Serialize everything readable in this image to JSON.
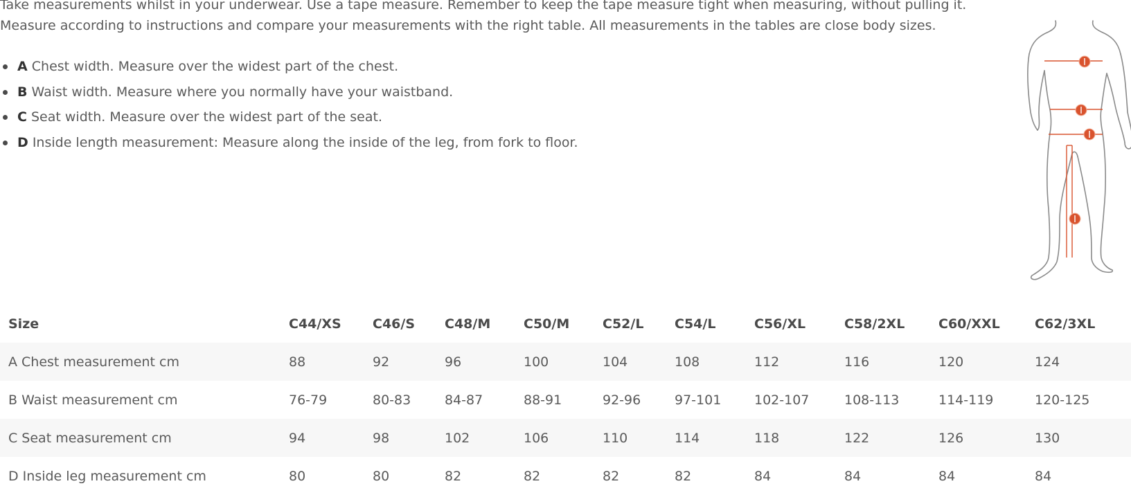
{
  "intro": {
    "line1": "Take measurements whilst in your underwear. Use a tape measure. Remember to keep the tape measure tight when measuring, without pulling it.",
    "line2": "Measure according to instructions and compare your measurements with the right table. All measurements in the tables are close body sizes."
  },
  "instructions": [
    {
      "key": "A",
      "text": " Chest width. Measure over the widest part of the chest."
    },
    {
      "key": "B",
      "text": " Waist width. Measure where you normally have your waistband."
    },
    {
      "key": "C",
      "text": " Seat width. Measure over the widest part of the seat."
    },
    {
      "key": "D",
      "text": " Inside length measurement: Measure along the inside of the leg, from fork to floor."
    }
  ],
  "figure": {
    "icon": "body-measurement-figure",
    "marker_color": "#d9532e",
    "outline_color": "#8a8a8a"
  },
  "table": {
    "headers": [
      "Size",
      "C44/XS",
      "C46/S",
      "C48/M",
      "C50/M",
      "C52/L",
      "C54/L",
      "C56/XL",
      "C58/2XL",
      "C60/XXL",
      "C62/3XL"
    ],
    "rows": [
      [
        "A Chest measurement cm",
        "88",
        "92",
        "96",
        "100",
        "104",
        "108",
        "112",
        "116",
        "120",
        "124"
      ],
      [
        "B Waist measurement cm",
        "76-79",
        "80-83",
        "84-87",
        "88-91",
        "92-96",
        "97-101",
        "102-107",
        "108-113",
        "114-119",
        "120-125"
      ],
      [
        "C Seat measurement cm",
        "94",
        "98",
        "102",
        "106",
        "110",
        "114",
        "118",
        "122",
        "126",
        "130"
      ],
      [
        "D Inside leg measurement cm",
        "80",
        "80",
        "82",
        "82",
        "82",
        "82",
        "84",
        "84",
        "84",
        "84"
      ]
    ]
  }
}
